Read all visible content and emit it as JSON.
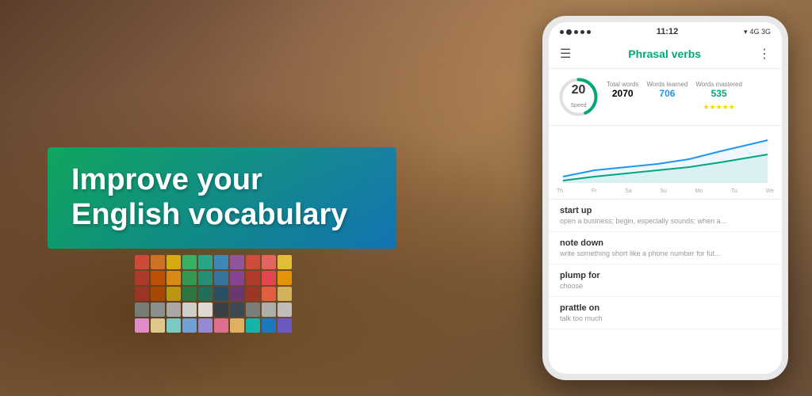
{
  "background": {
    "colors": [
      "#6b4423",
      "#8b6347",
      "#a07850",
      "#7a5c3a"
    ]
  },
  "left": {
    "headline_line1": "Improve your",
    "headline_line2": "English vocabulary"
  },
  "phone": {
    "status_bar": {
      "time": "11:12",
      "signal_label": "4G 3G"
    },
    "header": {
      "title": "Phrasal verbs",
      "menu_icon": "☰",
      "more_icon": "⋮"
    },
    "stats": {
      "speed_number": "20",
      "speed_label": "Speed",
      "total_words_label": "Total words",
      "total_words_value": "2070",
      "words_learned_label": "Words learned",
      "words_learned_value": "706",
      "words_mastered_label": "Words mastered",
      "words_mastered_value": "535",
      "stars": "★★★★★"
    },
    "chart": {
      "x_labels": [
        "Th",
        "Fr",
        "Sa",
        "Su",
        "Mo",
        "Tu",
        "We"
      ]
    },
    "words": [
      {
        "phrase": "start up",
        "definition": "open a business; begin, especially sounds; when a..."
      },
      {
        "phrase": "note down",
        "definition": "write something short like a phone number for fut..."
      },
      {
        "phrase": "plump for",
        "definition": "choose"
      },
      {
        "phrase": "prattle on",
        "definition": "talk too much"
      }
    ]
  },
  "swatches": {
    "colors": [
      "#e74c3c",
      "#e67e22",
      "#f1c40f",
      "#2ecc71",
      "#1abc9c",
      "#3498db",
      "#9b59b6",
      "#e74c3c",
      "#ff6b6b",
      "#ffd93d",
      "#c0392b",
      "#d35400",
      "#f39c12",
      "#27ae60",
      "#16a085",
      "#2980b9",
      "#8e44ad",
      "#c0392b",
      "#ff4757",
      "#ffa502",
      "#a93226",
      "#ba4a00",
      "#d4ac0d",
      "#1e8449",
      "#117a65",
      "#1a5276",
      "#6c3483",
      "#a93226",
      "#ff6348",
      "#eccc68",
      "#7f8c8d",
      "#95a5a6",
      "#bdc3c7",
      "#ecf0f1",
      "#ffffff",
      "#2c3e50",
      "#34495e",
      "#7f8c8d",
      "#bfc9ca",
      "#d5d8dc",
      "#ff9ff3",
      "#ffeaa7",
      "#81ecec",
      "#74b9ff",
      "#a29bfe",
      "#fd79a8",
      "#fdcb6e",
      "#00cec9",
      "#0984e3",
      "#6c5ce7"
    ]
  }
}
